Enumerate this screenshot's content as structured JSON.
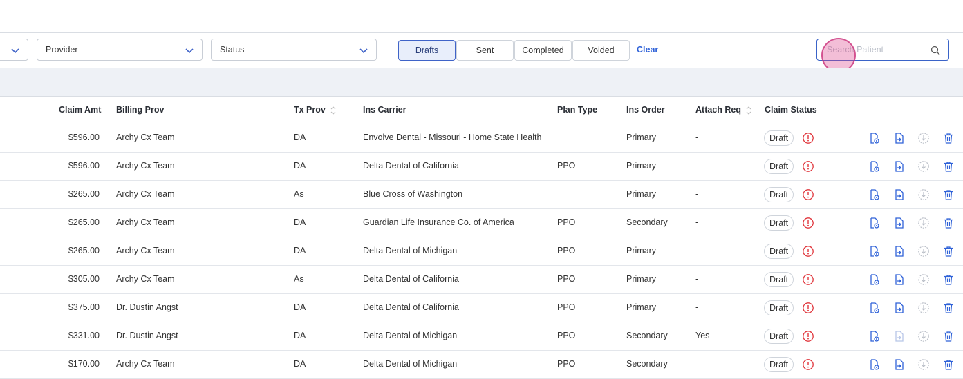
{
  "filters": {
    "provider_label": "Provider",
    "status_label": "Status",
    "segments": [
      "Drafts",
      "Sent",
      "Completed",
      "Voided"
    ],
    "active_segment": "Drafts",
    "clear_label": "Clear",
    "search_placeholder": "Search Patient"
  },
  "colors": {
    "accent": "#2f62d8",
    "alert": "#e0343a",
    "band": "#eef1f6"
  },
  "table": {
    "headers": {
      "claim_amt": "Claim Amt",
      "billing_prov": "Billing Prov",
      "tx_prov": "Tx Prov",
      "ins_carrier": "Ins Carrier",
      "plan_type": "Plan Type",
      "ins_order": "Ins Order",
      "attach_req": "Attach Req",
      "claim_status": "Claim Status"
    },
    "rows": [
      {
        "claim_amt": "$596.00",
        "billing_prov": "Archy Cx Team",
        "tx_prov": "DA",
        "ins_carrier": "Envolve Dental - Missouri - Home State Health",
        "plan_type": "",
        "ins_order": "Primary",
        "attach_req": "-",
        "status": "Draft"
      },
      {
        "claim_amt": "$596.00",
        "billing_prov": "Archy Cx Team",
        "tx_prov": "DA",
        "ins_carrier": "Delta Dental of California",
        "plan_type": "PPO",
        "ins_order": "Primary",
        "attach_req": "-",
        "status": "Draft"
      },
      {
        "claim_amt": "$265.00",
        "billing_prov": "Archy Cx Team",
        "tx_prov": "As",
        "ins_carrier": "Blue Cross of Washington",
        "plan_type": "",
        "ins_order": "Primary",
        "attach_req": "-",
        "status": "Draft"
      },
      {
        "claim_amt": "$265.00",
        "billing_prov": "Archy Cx Team",
        "tx_prov": "DA",
        "ins_carrier": "Guardian Life Insurance Co. of America",
        "plan_type": "PPO",
        "ins_order": "Secondary",
        "attach_req": "-",
        "status": "Draft"
      },
      {
        "claim_amt": "$265.00",
        "billing_prov": "Archy Cx Team",
        "tx_prov": "DA",
        "ins_carrier": "Delta Dental of Michigan",
        "plan_type": "PPO",
        "ins_order": "Primary",
        "attach_req": "-",
        "status": "Draft"
      },
      {
        "claim_amt": "$305.00",
        "billing_prov": "Archy Cx Team",
        "tx_prov": "As",
        "ins_carrier": "Delta Dental of California",
        "plan_type": "PPO",
        "ins_order": "Primary",
        "attach_req": "-",
        "status": "Draft"
      },
      {
        "claim_amt": "$375.00",
        "billing_prov": "Dr. Dustin Angst",
        "tx_prov": "DA",
        "ins_carrier": "Delta Dental of California",
        "plan_type": "PPO",
        "ins_order": "Primary",
        "attach_req": "-",
        "status": "Draft"
      },
      {
        "claim_amt": "$331.00",
        "billing_prov": "Dr. Dustin Angst",
        "tx_prov": "DA",
        "ins_carrier": "Delta Dental of Michigan",
        "plan_type": "PPO",
        "ins_order": "Secondary",
        "attach_req": "Yes",
        "status": "Draft"
      },
      {
        "claim_amt": "$170.00",
        "billing_prov": "Archy Cx Team",
        "tx_prov": "DA",
        "ins_carrier": "Delta Dental of Michigan",
        "plan_type": "PPO",
        "ins_order": "Secondary",
        "attach_req": "",
        "status": "Draft"
      }
    ]
  }
}
